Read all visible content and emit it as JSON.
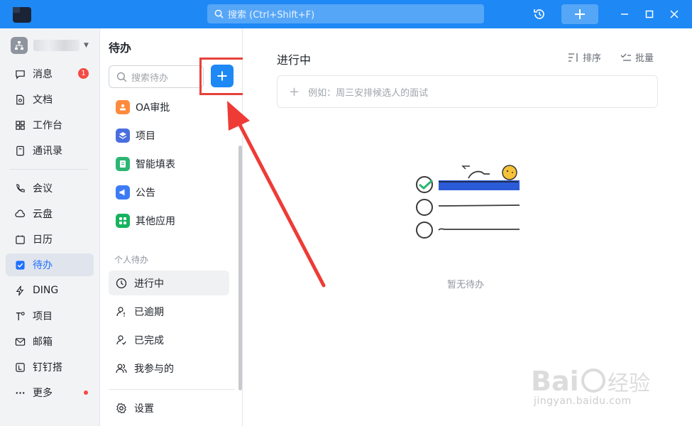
{
  "titlebar": {
    "search_placeholder": "搜索 (Ctrl+Shift+F)",
    "accent": "#1e88f5"
  },
  "leftnav": {
    "items": [
      {
        "label": "消息",
        "icon": "message-icon",
        "badge": "1"
      },
      {
        "label": "文档",
        "icon": "doc-icon"
      },
      {
        "label": "工作台",
        "icon": "workbench-icon"
      },
      {
        "label": "通讯录",
        "icon": "contacts-icon"
      },
      {
        "label": "会议",
        "icon": "meeting-icon"
      },
      {
        "label": "云盘",
        "icon": "cloud-icon"
      },
      {
        "label": "日历",
        "icon": "calendar-icon"
      },
      {
        "label": "待办",
        "icon": "todo-icon",
        "active": true
      },
      {
        "label": "DING",
        "icon": "ding-icon"
      },
      {
        "label": "项目",
        "icon": "project-icon"
      },
      {
        "label": "邮箱",
        "icon": "mail-icon"
      },
      {
        "label": "钉钉搭",
        "icon": "dingda-icon"
      },
      {
        "label": "更多",
        "icon": "more-icon",
        "dot": true
      }
    ]
  },
  "midcol": {
    "title": "待办",
    "search_placeholder": "搜索待办",
    "apps": [
      {
        "label": "OA审批",
        "icon": "oa-approval-icon",
        "color": "#ff8a3d"
      },
      {
        "label": "项目",
        "icon": "project-app-icon",
        "color": "#4a6ee0"
      },
      {
        "label": "智能填表",
        "icon": "smart-form-icon",
        "color": "#2bb673"
      },
      {
        "label": "公告",
        "icon": "announcement-icon",
        "color": "#3d7bf5"
      },
      {
        "label": "其他应用",
        "icon": "other-apps-icon",
        "color": "#16b35e"
      }
    ],
    "section_label": "个人待办",
    "tasks": [
      {
        "label": "进行中",
        "icon": "clock-icon",
        "active": true
      },
      {
        "label": "已逾期",
        "icon": "overdue-icon"
      },
      {
        "label": "已完成",
        "icon": "completed-icon"
      },
      {
        "label": "我参与的",
        "icon": "participants-icon"
      }
    ],
    "settings_label": "设置"
  },
  "main": {
    "title": "进行中",
    "sort_label": "排序",
    "batch_label": "批量",
    "quick_add_placeholder": "例如：周三安排候选人的面试",
    "empty_text": "暂无待办"
  },
  "watermark": {
    "sub": "jingyan.baidu.com"
  }
}
